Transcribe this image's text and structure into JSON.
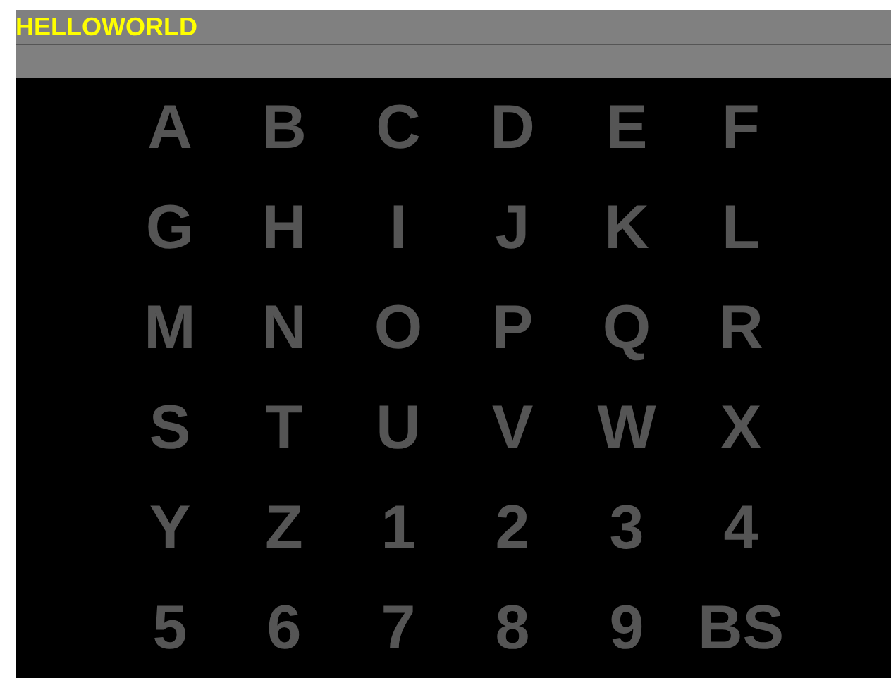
{
  "title": "HELLOWORLD",
  "keys": [
    "A",
    "B",
    "C",
    "D",
    "E",
    "F",
    "G",
    "H",
    "I",
    "J",
    "K",
    "L",
    "M",
    "N",
    "O",
    "P",
    "Q",
    "R",
    "S",
    "T",
    "U",
    "V",
    "W",
    "X",
    "Y",
    "Z",
    "1",
    "2",
    "3",
    "4",
    "5",
    "6",
    "7",
    "8",
    "9",
    "BS"
  ]
}
